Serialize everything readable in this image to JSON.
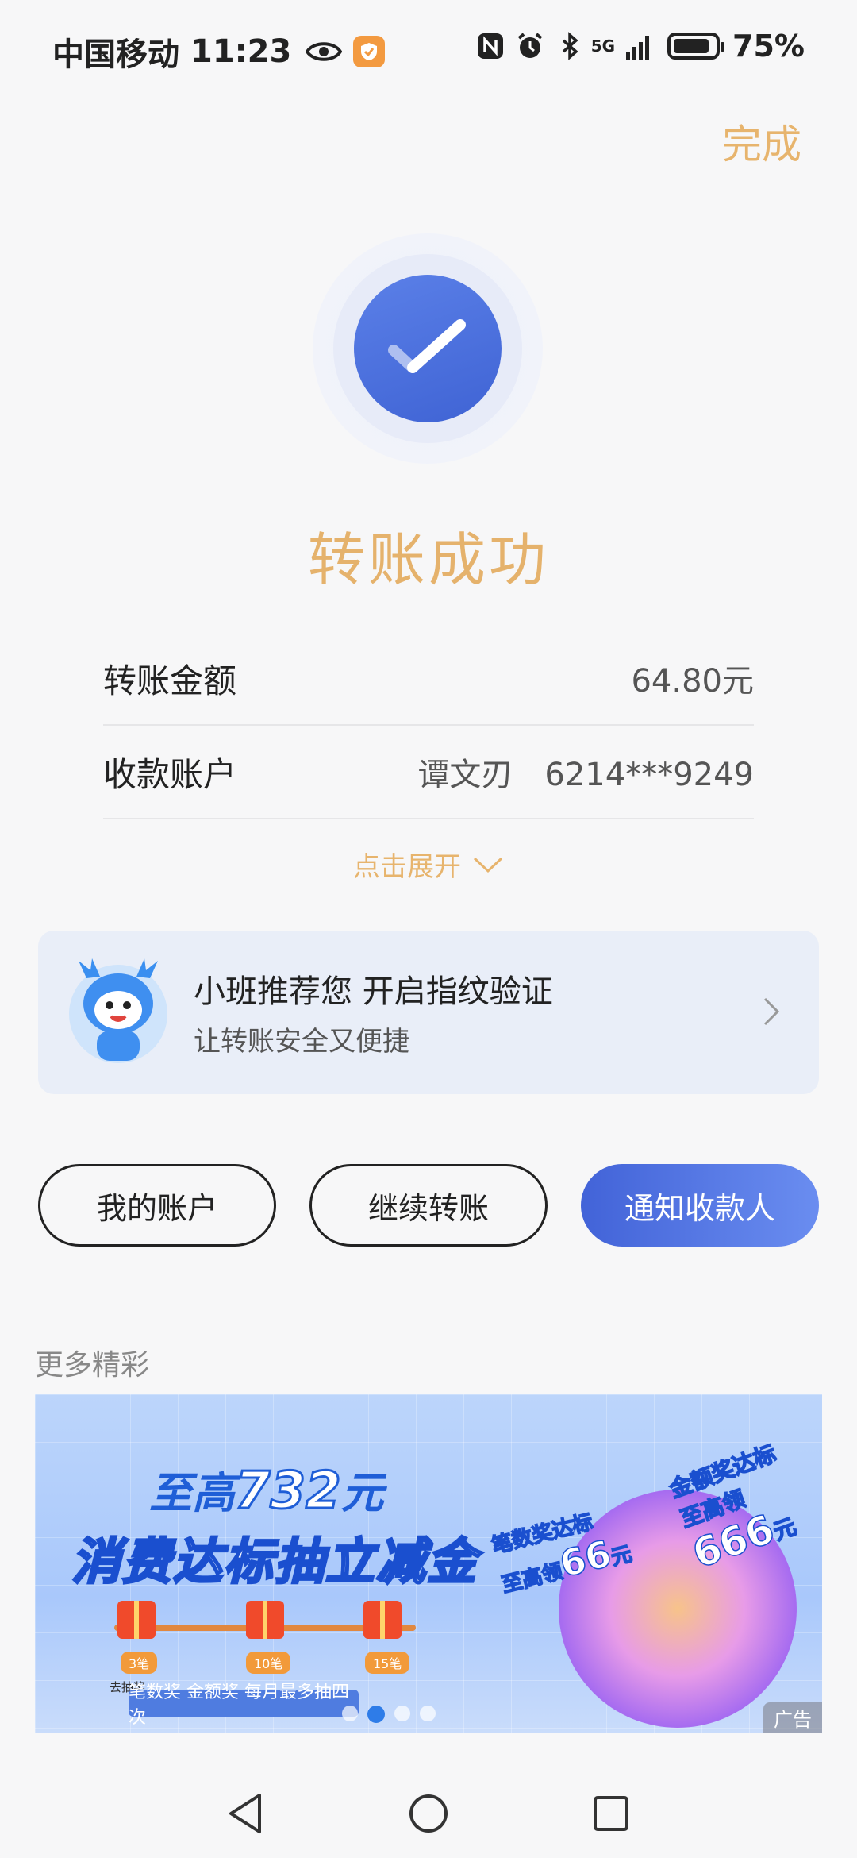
{
  "status_bar": {
    "carrier": "中国移动",
    "time": "11:23",
    "network": "5G",
    "battery": "75%",
    "battery_level": 0.75
  },
  "header": {
    "done_label": "完成"
  },
  "success": {
    "title": "转账成功",
    "icon": "checkmark-icon"
  },
  "details": {
    "amount_label": "转账金额",
    "amount_value": "64.80元",
    "payee_label": "收款账户",
    "payee_name": "谭文刃",
    "payee_account": "6214***9249",
    "expand_label": "点击展开"
  },
  "recommend": {
    "title": "小班推荐您 开启指纹验证",
    "subtitle": "让转账安全又便捷"
  },
  "actions": {
    "my_account": "我的账户",
    "continue_transfer": "继续转账",
    "notify_payee": "通知收款人"
  },
  "more": {
    "title": "更多精彩"
  },
  "banner": {
    "top_prefix": "至高",
    "top_number": "732",
    "top_suffix": "元",
    "headline": "消费达标抽立减金",
    "steps": [
      "3笔",
      "10笔",
      "15笔"
    ],
    "step_sub": "去抽奖",
    "subline": "笔数奖 金额奖 每月最多抽四次",
    "tag1_line1": "笔数奖达标",
    "tag1_prefix": "至高领",
    "tag1_number": "66",
    "tag1_suffix": "元",
    "tag2_line1": "金额奖达标",
    "tag2_prefix": "至高领",
    "tag2_number": "666",
    "tag2_suffix": "元",
    "ad_label": "广告",
    "active_page": 2,
    "page_count": 4
  },
  "colors": {
    "accent_gold": "#e5b26c",
    "primary_blue": "#4263d8"
  }
}
